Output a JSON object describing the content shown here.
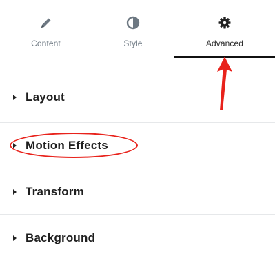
{
  "tabs": [
    {
      "label": "Content",
      "icon": "pencil-icon",
      "active": false
    },
    {
      "label": "Style",
      "icon": "half-circle-contrast-icon",
      "active": false
    },
    {
      "label": "Advanced",
      "icon": "gear-icon",
      "active": true
    }
  ],
  "sections": [
    {
      "title": "Layout"
    },
    {
      "title": "Motion Effects"
    },
    {
      "title": "Transform"
    },
    {
      "title": "Background"
    }
  ],
  "colors": {
    "annotation": "#e8221b",
    "active_underline": "#111111",
    "tab_label": "#6d7882",
    "section_title": "#1f1f1f",
    "divider": "#e6e8ea"
  }
}
